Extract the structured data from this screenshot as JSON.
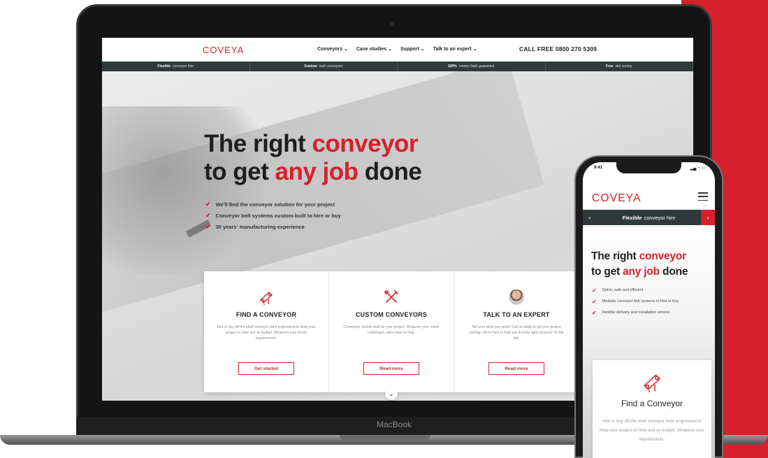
{
  "laptop": {
    "brand_label": "MacBook",
    "header": {
      "logo_text": "COVEYA",
      "nav": [
        "Conveyors",
        "Case studies",
        "Support",
        "Talk to an expert"
      ],
      "call": "CALL FREE 0800 270 5309"
    },
    "usp_bar": [
      {
        "bold": "Flexible",
        "rest": "conveyor hire"
      },
      {
        "bold": "Custom",
        "rest": "built conveyors"
      },
      {
        "bold": "100%",
        "rest": "money back guarantee"
      },
      {
        "bold": "Free",
        "rest": "site survey"
      }
    ],
    "hero": {
      "line1_a": "The right ",
      "line1_b": "conveyor",
      "line2_a": "to get ",
      "line2_b": "any job",
      "line2_c": " done",
      "checks": [
        "We'll find the conveyor solution for your project",
        "Conveyor belt systems custom-built to hire or buy",
        "30 years' manufacturing experience"
      ]
    },
    "cards": [
      {
        "icon": "conveyor-icon",
        "title": "FIND A CONVEYOR",
        "text": "Hire or buy off-the-shelf conveyor belts engineered to keep your project on time and on budget. Whatever your onsite requirements.",
        "button": "Get started"
      },
      {
        "icon": "tools-icon",
        "title": "CUSTOM CONVEYORS",
        "text": "Conveyors custom-built for your project. Whatever your onsite challenges, we're here to help.",
        "button": "Read more"
      },
      {
        "icon": "expert-avatar",
        "title": "TALK TO AN EXPERT",
        "text": "Not sure what you need? Call us today to get your project moving. We're here to help you find the right conveyor for the job.",
        "button": "Read more"
      }
    ]
  },
  "phone": {
    "time": "9:41",
    "logo_text": "COVEYA",
    "bar": {
      "bold": "Flexible",
      "rest": "conveyor hire"
    },
    "hero": {
      "line1_a": "The right ",
      "line1_b": "conveyor",
      "line2_a": "to get ",
      "line2_b": "any job",
      "line2_c": " done",
      "checks": [
        "Quick, safe and efficient",
        "Modular conveyor belt systems to hire or buy",
        "Flexible delivery and installation service"
      ]
    },
    "card": {
      "title": "Find a Conveyor",
      "text": "Hire or buy off-the-shelf conveyor belts engineered to keep your project on time and on budget. Whatever your requirements."
    }
  },
  "colors": {
    "brand_red": "#d6202c",
    "bar_dark": "#2f3a3a"
  }
}
